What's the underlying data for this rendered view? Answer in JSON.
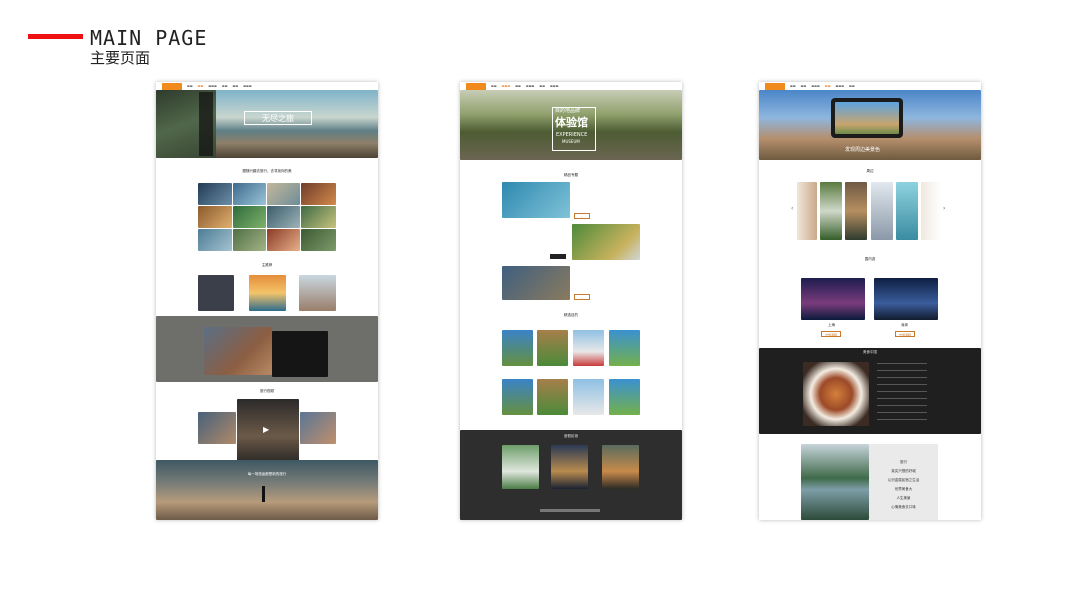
{
  "header": {
    "title": "MAIN PAGE",
    "subtitle": "主要页面"
  },
  "mock1": {
    "hero_text": "无尽之旅",
    "section1_title": "跟随兴趣去旅行，去寻找你的美",
    "section2_title": "主推荐",
    "section3_title": "旅行视频",
    "footer_text": "每一场旅途都是新的旅行"
  },
  "mock2": {
    "hero_cn_small": "目的地品牌",
    "hero_cn_big": "体验馆",
    "hero_en": "EXPERIENCE",
    "hero_en2": "MUSEUM",
    "section1_title": "精品专题",
    "section2_title": "精选目的",
    "section3_title": "度假民宿"
  },
  "mock3": {
    "hero_caption": "发现周边美景色",
    "section1_title": "周边",
    "section2_title": "国内游",
    "city1": "上海",
    "city2": "深圳",
    "btn1": "去旅游吧",
    "btn2": "去旅游吧",
    "section3_title": "美食中国",
    "menu": [
      "旅行",
      "真实只想的好城",
      "认识金属民宿之生活",
      "世界美食大",
      "人生美景",
      "心情美食去口味"
    ]
  },
  "colors": {
    "accent": "#e11111",
    "brand_orange": "#f08a1c"
  }
}
